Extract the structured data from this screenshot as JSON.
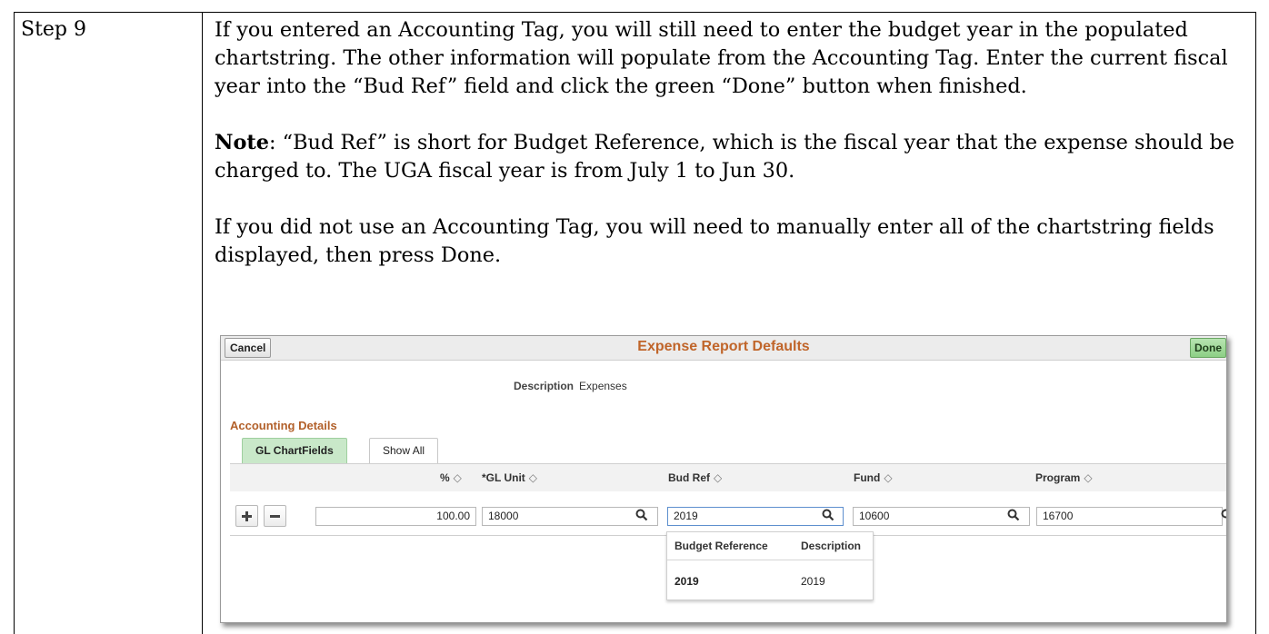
{
  "step_label": "Step 9",
  "paragraph_1": "If you entered an Accounting Tag, you will still need to enter the budget year in the populated chartstring.  The other information will populate from the Accounting Tag.  Enter the current fiscal year into the “Bud Ref” field and click the green “Done” button when finished.",
  "note_label": "Note",
  "note_text": ": “Bud Ref” is short for Budget Reference, which is the fiscal year that the expense should be charged to.  The UGA fiscal year is from July 1 to Jun 30.",
  "paragraph_3": "If you did not use an Accounting Tag, you will need to manually enter all of the chartstring fields displayed, then press Done.",
  "screenshot": {
    "title": "Expense Report Defaults",
    "cancel_label": "Cancel",
    "done_label": "Done",
    "description_label": "Description",
    "description_value": "Expenses",
    "section_title": "Accounting Details",
    "tabs": [
      "GL ChartFields",
      "Show All"
    ],
    "columns": [
      "%",
      "*GL Unit",
      "Bud Ref",
      "Fund",
      "Program"
    ],
    "sort_glyph": "◇",
    "row": {
      "percent": "100.00",
      "gl_unit": "18000",
      "bud_ref": "2019",
      "fund": "10600",
      "program": "16700"
    },
    "lookup": {
      "headers": [
        "Budget Reference",
        "Description"
      ],
      "values": [
        "2019",
        "2019"
      ]
    },
    "colors": {
      "title": "#c0652a",
      "section_title": "#b2602a",
      "active_tab": "#c9e8c9",
      "done_button": "#8dcf85"
    },
    "icons": [
      "plus-icon",
      "minus-icon",
      "search-icon"
    ]
  }
}
